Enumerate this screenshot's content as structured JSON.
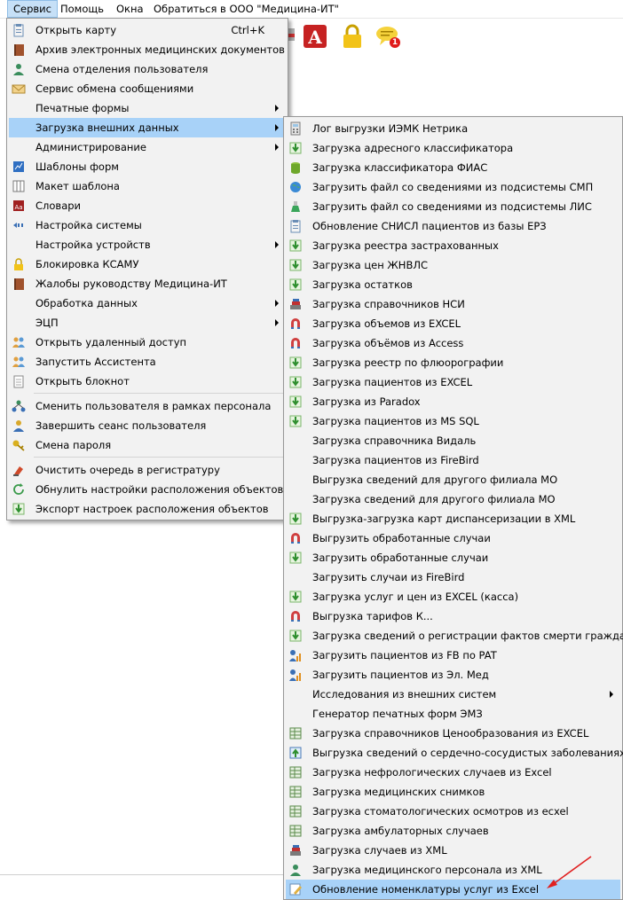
{
  "menubar": {
    "items": [
      {
        "label": "Сервис"
      },
      {
        "label": "Помощь"
      },
      {
        "label": "Окна"
      },
      {
        "label": "Обратиться в ООО \"Медицина-ИТ\""
      }
    ]
  },
  "service_menu": {
    "items": [
      {
        "label": "Открыть карту",
        "shortcut": "Ctrl+K",
        "icon": "clipboard-icon"
      },
      {
        "label": "Архив электронных медицинских документов",
        "icon": "book-icon"
      },
      {
        "label": "Смена отделения пользователя",
        "icon": "user-icon"
      },
      {
        "label": "Сервис обмена сообщениями",
        "icon": "envelope-icon"
      },
      {
        "label": "Печатные формы",
        "icon": "",
        "submenu": true
      },
      {
        "label": "Загрузка внешних данных",
        "icon": "",
        "submenu": true
      },
      {
        "label": "Администрирование",
        "icon": "",
        "submenu": true
      },
      {
        "label": "Шаблоны форм",
        "icon": "chart-icon"
      },
      {
        "label": "Макет шаблона",
        "icon": "grid-icon"
      },
      {
        "label": "Словари",
        "icon": "dictionary-icon"
      },
      {
        "label": "Настройка системы",
        "icon": "settings-icon"
      },
      {
        "label": "Настройка устройств",
        "icon": "",
        "submenu": true
      },
      {
        "label": "Блокировка КСАМУ",
        "icon": "lock-icon"
      },
      {
        "label": "Жалобы руководству Медицина-ИТ",
        "icon": "book-icon"
      },
      {
        "label": "Обработка данных",
        "icon": "",
        "submenu": true
      },
      {
        "label": "ЭЦП",
        "icon": "",
        "submenu": true
      },
      {
        "label": "Открыть удаленный доступ",
        "icon": "people-icon"
      },
      {
        "label": "Запустить Ассистента",
        "icon": "people-icon"
      },
      {
        "label": "Открыть блокнот",
        "icon": "notepad-icon"
      },
      {
        "label": "Сменить пользователя в рамках персонала",
        "icon": "network-icon"
      },
      {
        "label": "Завершить сеанс пользователя",
        "icon": "user-logout-icon"
      },
      {
        "label": "Смена пароля",
        "icon": "key-icon"
      },
      {
        "label": "Очистить очередь в регистратуру",
        "icon": "clear-icon"
      },
      {
        "label": "Обнулить настройки расположения объектов",
        "icon": "refresh-icon"
      },
      {
        "label": "Экспорт настроек расположения объектов",
        "icon": "download-icon"
      }
    ]
  },
  "external_data_menu": {
    "items": [
      {
        "label": "Лог выгрузки ИЭМК Нетрика",
        "icon": "calculator-icon"
      },
      {
        "label": "Загрузка адресного классификатора",
        "icon": "download-icon"
      },
      {
        "label": "Загрузка классификатора ФИАС",
        "icon": "database-icon"
      },
      {
        "label": "Загрузить файл со сведениями из подсистемы СМП",
        "icon": "globe-icon"
      },
      {
        "label": "Загрузить файл со сведениями из подсистемы ЛИС",
        "icon": "flask-icon"
      },
      {
        "label": "Обновление СНИСЛ пациентов из базы ЕРЗ",
        "icon": "clipboard-icon"
      },
      {
        "label": "Загрузка реестра застрахованных",
        "icon": "download-icon"
      },
      {
        "label": "Загрузка цен ЖНВЛС",
        "icon": "download-icon"
      },
      {
        "label": "Загрузка остатков",
        "icon": "download-icon"
      },
      {
        "label": "Загрузка справочников НСИ",
        "icon": "stack-icon"
      },
      {
        "label": "Загрузка объемов из EXCEL",
        "icon": "magnet-icon"
      },
      {
        "label": "Загрузка объёмов из Access",
        "icon": "magnet-icon"
      },
      {
        "label": "Загрузка реестр по флюорографии",
        "icon": "download-icon"
      },
      {
        "label": "Загрузка пациентов из EXCEL",
        "icon": "download-icon"
      },
      {
        "label": "Загрузка из Paradox",
        "icon": "download-icon"
      },
      {
        "label": "Загрузка пациентов из MS SQL",
        "icon": "download-icon"
      },
      {
        "label": "Загрузка справочника Видаль",
        "icon": ""
      },
      {
        "label": "Загрузка пациентов из FireBird",
        "icon": ""
      },
      {
        "label": "Выгрузка сведений для другого филиала МО",
        "icon": ""
      },
      {
        "label": "Загрузка сведений для другого филиала МО",
        "icon": ""
      },
      {
        "label": "Выгрузка-загрузка карт диспансеризации в XML",
        "icon": "download-icon"
      },
      {
        "label": "Выгрузить обработанные случаи",
        "icon": "magnet-icon"
      },
      {
        "label": "Загрузить обработанные случаи",
        "icon": "download-icon"
      },
      {
        "label": "Загрузить случаи из FireBird",
        "icon": ""
      },
      {
        "label": "Загрузка услуг и цен из EXCEL (касса)",
        "icon": "download-icon"
      },
      {
        "label": "Выгрузка тарифов К...",
        "icon": "magnet-icon"
      },
      {
        "label": "Загрузка сведений о регистрации фактов смерти граждан",
        "icon": "download-icon"
      },
      {
        "label": "Загрузить пациентов из FB по PAT",
        "icon": "user-chart-icon"
      },
      {
        "label": "Загрузить пациентов из Эл. Мед",
        "icon": "user-chart-icon"
      },
      {
        "label": "Исследования из внешних систем",
        "icon": "",
        "submenu": true
      },
      {
        "label": "Генератор печатных форм ЭМЗ",
        "icon": ""
      },
      {
        "label": "Загрузка справочников Ценообразования  из EXCEL",
        "icon": "table-icon"
      },
      {
        "label": "Выгрузка сведений о сердечно-сосудистых заболеваниях",
        "icon": "upload-icon"
      },
      {
        "label": "Загрузка нефрологических случаев из Excel",
        "icon": "table-icon"
      },
      {
        "label": "Загрузка медицинских снимков",
        "icon": "table-icon"
      },
      {
        "label": "Загрузка стоматологических осмотров из ecxel",
        "icon": "table-icon"
      },
      {
        "label": "Загрузка амбулаторных случаев",
        "icon": "table-icon"
      },
      {
        "label": "Загрузка случаев из XML",
        "icon": "stack-icon"
      },
      {
        "label": "Загрузка медицинского персонала из XML",
        "icon": "user-icon"
      },
      {
        "label": "Обновление номенклатуры услуг из Excel",
        "icon": "edit-note-icon"
      }
    ]
  },
  "toolbar": {
    "icons": [
      "printer-icon",
      "pdf-icon",
      "lock-icon",
      "message-alert-icon"
    ],
    "badge": "1"
  },
  "colors": {
    "highlight": "#a8d2f8",
    "menu_bg": "#f2f2f2",
    "annotation": "#e02020"
  }
}
